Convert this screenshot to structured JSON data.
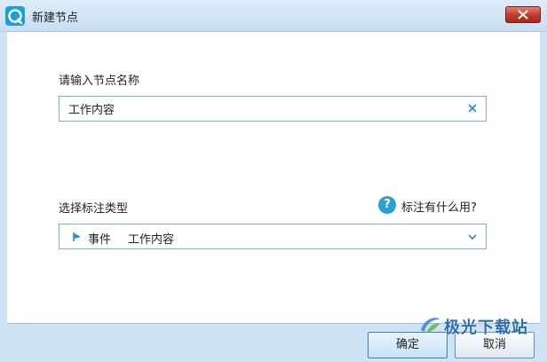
{
  "window": {
    "title": "新建节点",
    "app_icon": "app-logo-icon",
    "close_icon": "close-icon"
  },
  "form": {
    "name_label": "请输入节点名称",
    "name_value": "工作内容",
    "clear_icon": "clear-x-icon",
    "type_label": "选择标注类型",
    "help_text": "标注有什么用?",
    "help_icon_glyph": "?",
    "type_selected_event": "事件",
    "type_selected_content": "工作内容",
    "flag_icon": "flag-icon",
    "dropdown_icon": "chevron-down-icon"
  },
  "buttons": {
    "ok_label": "确定",
    "cancel_label": "取消"
  },
  "watermark": {
    "text": "极光下载站"
  },
  "colors": {
    "accent": "#2aa1d5",
    "title_bar": "#cfe3f6",
    "close_button": "#c0392b",
    "input_border": "#7fb0cc"
  }
}
